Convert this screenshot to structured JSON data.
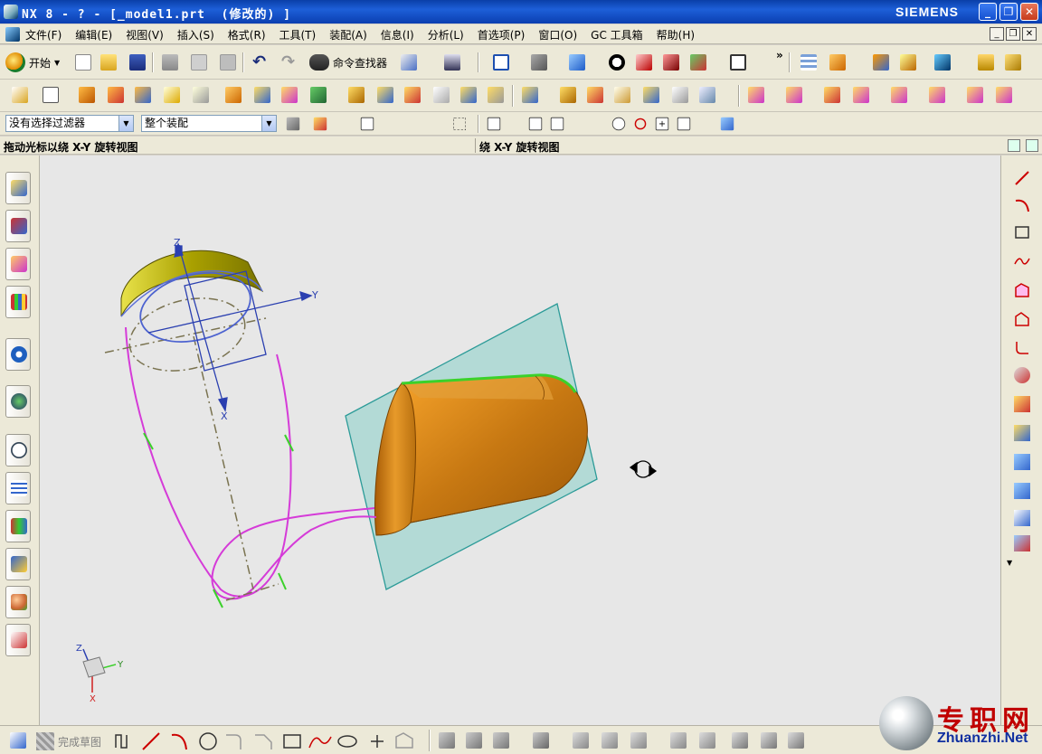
{
  "window": {
    "title": "NX 8 - ? - [_model1.prt  (修改的) ]",
    "brand": "SIEMENS",
    "controls": [
      "_",
      "❐",
      "✕"
    ]
  },
  "menubar": {
    "items": [
      "文件(F)",
      "编辑(E)",
      "视图(V)",
      "插入(S)",
      "格式(R)",
      "工具(T)",
      "装配(A)",
      "信息(I)",
      "分析(L)",
      "首选项(P)",
      "窗口(O)",
      "GC 工具箱",
      "帮助(H)"
    ],
    "mdi_controls": [
      "_",
      "❐",
      "✕"
    ]
  },
  "toolbar_standard": {
    "start_label": "开始",
    "command_finder_label": "命令查找器",
    "more_label": "»"
  },
  "selection_bar": {
    "filter_value": "没有选择过滤器",
    "scope_value": "整个装配"
  },
  "cue_line": {
    "cue": "拖动光标以绕 X-Y 旋转视图",
    "status": "绕 X-Y 旋转视图"
  },
  "graphics": {
    "csys_labels": {
      "z": "Z",
      "y": "Y",
      "x": "X"
    },
    "triad_labels": {
      "z": "Z",
      "y": "Y",
      "x": "X"
    },
    "colors": {
      "background": "#e7e7e7",
      "solid_body": "#b86f10",
      "sweep_path": "#d53bd8",
      "datum_plane": "#b3dad6",
      "ring_body": "#c8c000",
      "csys": "#2a3fb0"
    }
  },
  "sketch_bar": {
    "finish_sketch_label": "完成草图"
  },
  "watermark": {
    "cn": "专职网",
    "url": "Zhuanzhi.Net"
  }
}
